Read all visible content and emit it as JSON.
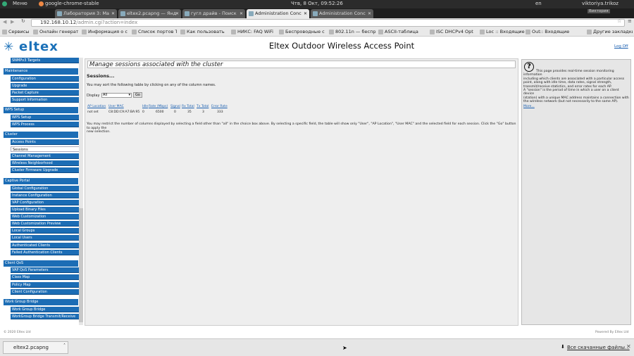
{
  "os_bar": {
    "menu": "Меню",
    "app": "google-chrome-stable",
    "clock": "Чтв,  8 Окт, 09:52:26",
    "lang": "en",
    "user": "viktoriya.trikoz"
  },
  "tabs": [
    {
      "label": "Лаборатория 3: Ма"
    },
    {
      "label": "eltex2.pcapng — Янд"
    },
    {
      "label": "гугл драйв - Поиск"
    },
    {
      "label": "Administration Conc"
    },
    {
      "label": "Administration Conc"
    }
  ],
  "window_user": "Виктория",
  "url": {
    "host": "192.168.10.12",
    "path": "/admin.cgi?action=index"
  },
  "bookmarks": [
    "Сервисы",
    "Онлайн генерато",
    "Информация о с",
    "Список портов Т",
    "Как пользовать",
    "НИКС: FAQ WiFi",
    "Беспроводные с",
    "802.11n — беспр",
    "ASCII-таблица",
    "ISC DHCPv4 Opt",
    "Loc :: Входящие",
    "Out:: Входящие",
    "Другие закладки"
  ],
  "header": {
    "logo": "eltex",
    "title": "Eltex Outdoor Wireless Access Point",
    "logout": "Log Off"
  },
  "sidebar": {
    "groups": [
      {
        "label": "SNMPv3 Targets",
        "item": true
      },
      {
        "label": "Maintenance"
      },
      {
        "label": "Configuration",
        "item": true
      },
      {
        "label": "Upgrade",
        "item": true
      },
      {
        "label": "Packet Capture",
        "item": true
      },
      {
        "label": "Support Information",
        "item": true
      },
      {
        "label": "WPS Setup"
      },
      {
        "label": "WPS Setup",
        "item": true
      },
      {
        "label": "WPS Process",
        "item": true
      },
      {
        "label": "Cluster"
      },
      {
        "label": "Access Points",
        "item": true
      },
      {
        "label": "Sessions",
        "item": true,
        "selected": true
      },
      {
        "label": "Channel Management",
        "item": true
      },
      {
        "label": "Wireless Neighborhood",
        "item": true
      },
      {
        "label": "Cluster Firmware Upgrade",
        "item": true
      },
      {
        "label": "Captive Portal"
      },
      {
        "label": "Global Configuration",
        "item": true
      },
      {
        "label": "Instance Configuration",
        "item": true
      },
      {
        "label": "VAP Configuration",
        "item": true
      },
      {
        "label": "Upload Binary Files",
        "item": true
      },
      {
        "label": "Web Customization",
        "item": true
      },
      {
        "label": "Web Customization Preview",
        "item": true
      },
      {
        "label": "Local Groups",
        "item": true
      },
      {
        "label": "Local Users",
        "item": true
      },
      {
        "label": "Authenticated Clients",
        "item": true
      },
      {
        "label": "Failed Authentication Clients",
        "item": true
      },
      {
        "label": "Client QoS"
      },
      {
        "label": "VAP QoS Parameters",
        "item": true
      },
      {
        "label": "Class Map",
        "item": true
      },
      {
        "label": "Policy Map",
        "item": true
      },
      {
        "label": "Client Configuration",
        "item": true
      },
      {
        "label": "Work Group Bridge"
      },
      {
        "label": "Work Group Bridge",
        "item": true
      },
      {
        "label": "WorkGroup Bridge Transmit/Receive",
        "item": true
      }
    ]
  },
  "main": {
    "section_title": "Manage sessions associated with the cluster",
    "subtitle": "Sessions...",
    "sort_hint": "You may sort the following table by clicking on any of the column names.",
    "display_label": "Display",
    "display_value": "All",
    "go_label": "Go",
    "columns": [
      "AP Location",
      "User MAC",
      "Idle",
      "Rate (Mbps)",
      "Signal",
      "Rx Total",
      "Tx Total",
      "Error Rate"
    ],
    "rows": [
      [
        "not set",
        "C8:DD:C9:A7:BA:95",
        "0",
        "6500",
        "0",
        "35",
        "3",
        "333"
      ]
    ],
    "restrict_hint_1": "You may restrict the number of columns displayed by selecting a field other than \"all\" in the choice box above.  By selecting a specific field, the table will show only \"User\", \"AP Location\", \"User MAC\" and the selected field for each session.  Click the \"Go\" button to apply the",
    "restrict_hint_2": "new selection."
  },
  "help": {
    "p1": [
      "This page provides real-time session monitoring information",
      "including which clients are associated with a particular access",
      "point, along with idle time, data rates, signal strength,",
      "transmit/receive statistics, and error rates for each AP."
    ],
    "p2": [
      "A \"session\" is the period of time in which a user on a client device",
      "(station) with a unique MAC address maintains a connection with",
      "the wireless network (but not necessarily to the same AP)."
    ],
    "more": "More..."
  },
  "footer": {
    "left": "© 2020 Eltex Ltd",
    "right": "Powered By Eltex Ltd"
  },
  "download_bar": {
    "file": "eltex2.pcapng",
    "show_all": "Все скачанные файлы..."
  }
}
